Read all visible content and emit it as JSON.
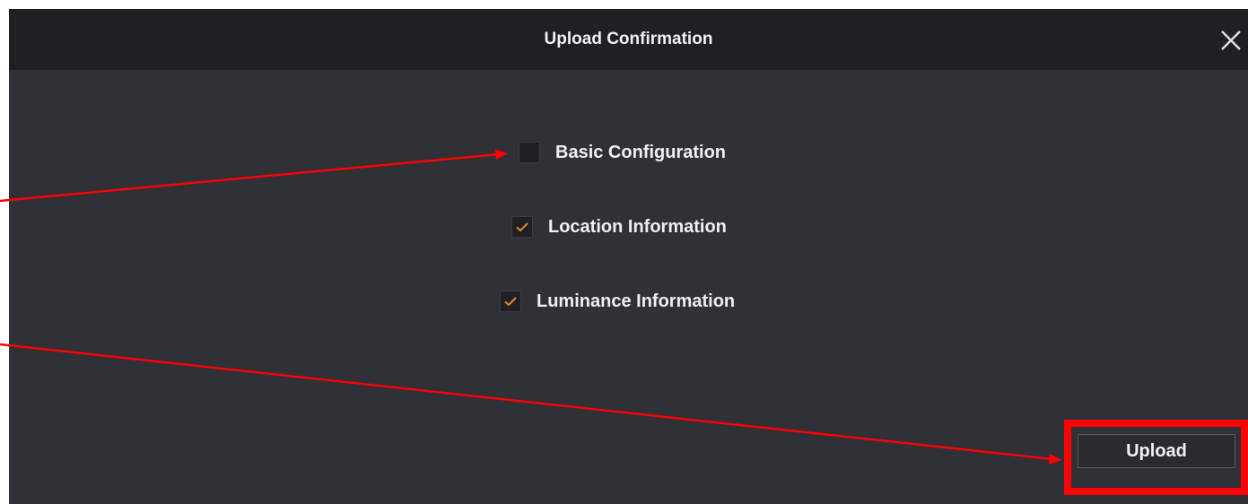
{
  "dialog": {
    "title": "Upload Confirmation",
    "close_icon": "close-icon"
  },
  "options": [
    {
      "label": "Basic Configuration",
      "checked": false
    },
    {
      "label": "Location Information",
      "checked": true
    },
    {
      "label": "Luminance Information",
      "checked": true
    }
  ],
  "upload_button": {
    "label": "Upload"
  },
  "colors": {
    "dialog_background": "#303037",
    "titlebar_background": "#1f1f24",
    "checkmark": "#e08a2c",
    "annotation": "#ff0000"
  }
}
